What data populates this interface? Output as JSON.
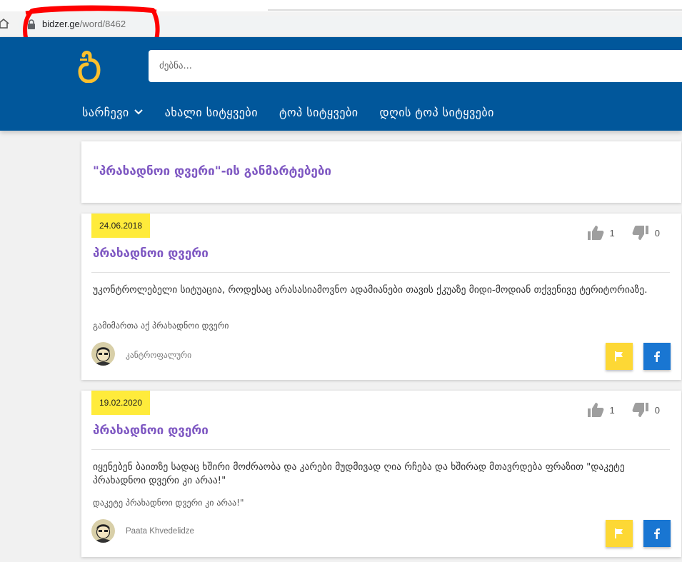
{
  "browser": {
    "url_domain": "bidzer.ge",
    "url_path": "/word/8462"
  },
  "header": {
    "logo_glyph": "ბ",
    "search_placeholder": "ძებნა...",
    "nav": [
      {
        "label": "სარჩევი"
      },
      {
        "label": "ახალი სიტყვები"
      },
      {
        "label": "ტოპ სიტყვები"
      },
      {
        "label": "დღის ტოპ სიტყვები"
      }
    ]
  },
  "page": {
    "heading": "\"პრახადნოი დვერი\"-ის განმარტებები"
  },
  "definitions": [
    {
      "date": "24.06.2018",
      "likes": "1",
      "dislikes": "0",
      "word": "პრახადნოი დვერი",
      "text": "უკონტროლებელი სიტუაცია, როდესაც არასასიამოვნო ადამიანები თავის ქკუაზე მიდი-მოდიან თქვენივე ტერიტორიაზე.",
      "example": "გამიმართა აქ პრახადნოი დვერი",
      "author": "კანტროფალური"
    },
    {
      "date": "19.02.2020",
      "likes": "1",
      "dislikes": "0",
      "word": "პრახადნოი დვერი",
      "text": "იყენებენ ბაითზე სადაც ხშირი მოძრაობა და კარები მუდმივად ღია რჩება და ხშირად მთავრდება ფრაზით \"დაკეტე პრახადნოი დვერი კი არაა!\"",
      "example": "დაკეტე პრახადნოი დვერი კი არაა!\"",
      "author": "Paata Khvedelidze"
    }
  ],
  "colors": {
    "header_blue": "#01579b",
    "accent_purple": "#7e57c2",
    "date_yellow": "#ffeb3b",
    "flag_yellow": "#fdd835",
    "facebook_blue": "#1976d2",
    "annotation_red": "#ff0000"
  }
}
